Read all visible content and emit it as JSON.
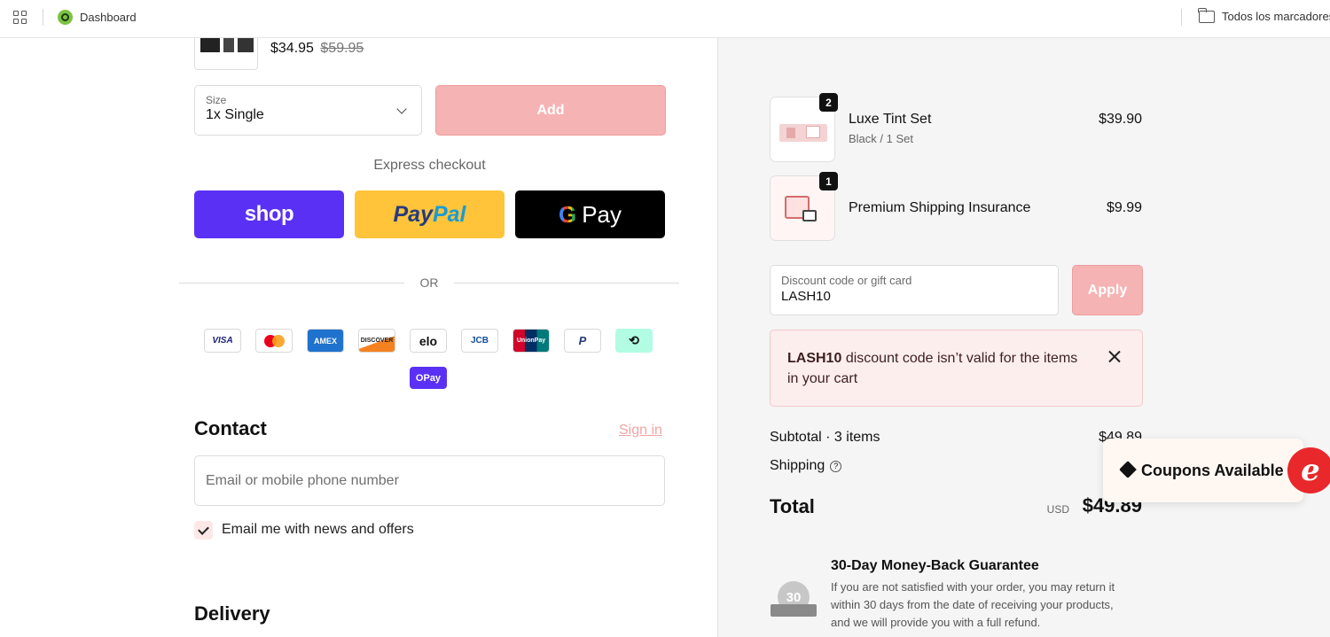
{
  "bookmarks": {
    "dashboard_label": "Dashboard",
    "folder_label": "Todos los marcadores"
  },
  "product": {
    "price": "$34.95",
    "compare_price": "$59.95",
    "size_label": "Size",
    "size_value": "1x Single",
    "add_label": "Add"
  },
  "express": {
    "title": "Express checkout",
    "shop_label": "shop",
    "paypal_part1": "Pay",
    "paypal_part2": "Pal",
    "gpay_g": "G",
    "gpay_label": "Pay",
    "or_label": "OR"
  },
  "payment_methods": [
    "VISA",
    "Mastercard",
    "AMEX",
    "DISCOVER",
    "elo",
    "JCB",
    "UnionPay",
    "PayPal",
    "Afterpay",
    "OPay"
  ],
  "payment_labels": {
    "visa": "VISA",
    "amex": "AMEX",
    "discover": "DISCOVER",
    "elo": "elo",
    "jcb": "JCB",
    "unionpay": "UnionPay",
    "paypal": "P",
    "opay": "OPay"
  },
  "contact": {
    "heading": "Contact",
    "signin_label": "Sign in",
    "email_placeholder": "Email or mobile phone number",
    "newsletter_label": "Email me with news and offers",
    "newsletter_checked": true
  },
  "delivery": {
    "heading": "Delivery"
  },
  "cart": {
    "items": [
      {
        "qty": "2",
        "name": "Luxe Tint Set",
        "variant": "Black / 1 Set",
        "price": "$39.90"
      },
      {
        "qty": "1",
        "name": "Premium Shipping Insurance",
        "variant": "",
        "price": "$9.99"
      }
    ]
  },
  "discount": {
    "label": "Discount code or gift card",
    "value": "LASH10",
    "apply_label": "Apply",
    "error_code": "LASH10",
    "error_message": "discount code isn’t valid for the items in your cart"
  },
  "summary": {
    "subtotal_label": "Subtotal · 3 items",
    "subtotal_value": "$49.89",
    "shipping_label": "Shipping",
    "total_label": "Total",
    "currency": "USD",
    "total_value": "$49.89"
  },
  "coupon": {
    "label": "Coupons Available",
    "logo_letter": "e"
  },
  "guarantee": {
    "badge_number": "30",
    "title": "30-Day Money-Back Guarantee",
    "text": "If you are not satisfied with your order, you may return it within 30 days from the date of receiving your products, and we will provide you with a full refund."
  },
  "colors": {
    "accent_pink": "#f6b3b3",
    "shop_purple": "#5a31f4",
    "paypal_yellow": "#ffc439",
    "error_bg": "#fdeeee"
  }
}
